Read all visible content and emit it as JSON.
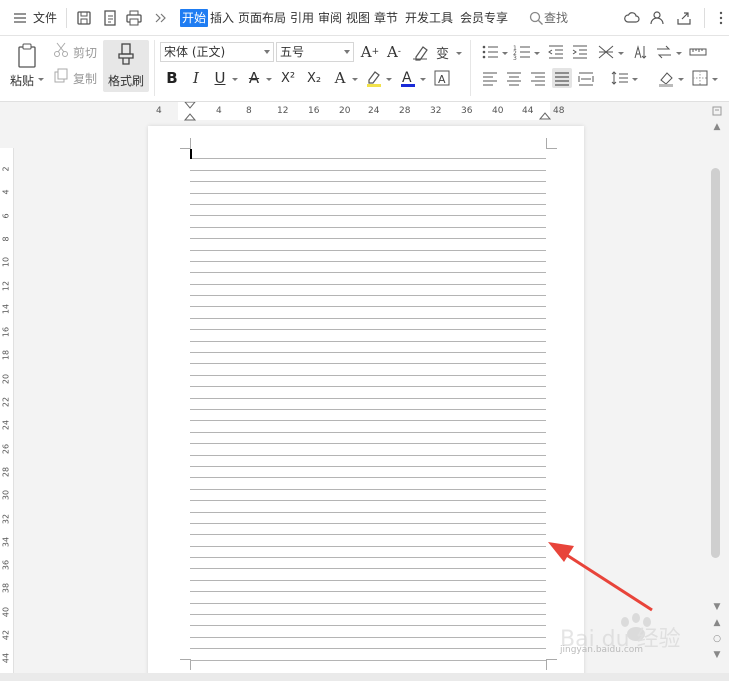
{
  "menubar": {
    "file_label": "文件",
    "tabs": [
      {
        "label": "开始",
        "active": true
      },
      {
        "label": "插入"
      },
      {
        "label": "页面布局"
      },
      {
        "label": "引用"
      },
      {
        "label": "审阅"
      },
      {
        "label": "视图"
      },
      {
        "label": "章节"
      },
      {
        "label": "开发工具"
      },
      {
        "label": "会员专享"
      }
    ],
    "search_label": "查找",
    "accent_color": "#1e7cf2"
  },
  "ribbon": {
    "paste_label": "粘贴",
    "cut_label": "剪切",
    "copy_label": "复制",
    "format_painter_label": "格式刷",
    "font_name": "宋体 (正文)",
    "font_size": "五号",
    "bold": "B",
    "italic": "I",
    "underline": "U",
    "strike": "A",
    "superscript": "X²",
    "subscript": "X₂",
    "font_color_hex": "#1a2bd8"
  },
  "ruler": {
    "h_ticks": [
      "4",
      "4",
      "8",
      "12",
      "16",
      "20",
      "24",
      "28",
      "32",
      "36",
      "40",
      "44",
      "48"
    ],
    "v_ticks": [
      "2",
      "4",
      "6",
      "8",
      "10",
      "12",
      "14",
      "16",
      "18",
      "20",
      "22",
      "24",
      "26",
      "28",
      "30",
      "32",
      "34",
      "36",
      "38",
      "40",
      "42",
      "44"
    ]
  },
  "watermark": {
    "brand": "Bai du 经验",
    "url": "jingyan.baidu.com"
  },
  "annotation": {
    "arrow_color": "#e8443a"
  }
}
